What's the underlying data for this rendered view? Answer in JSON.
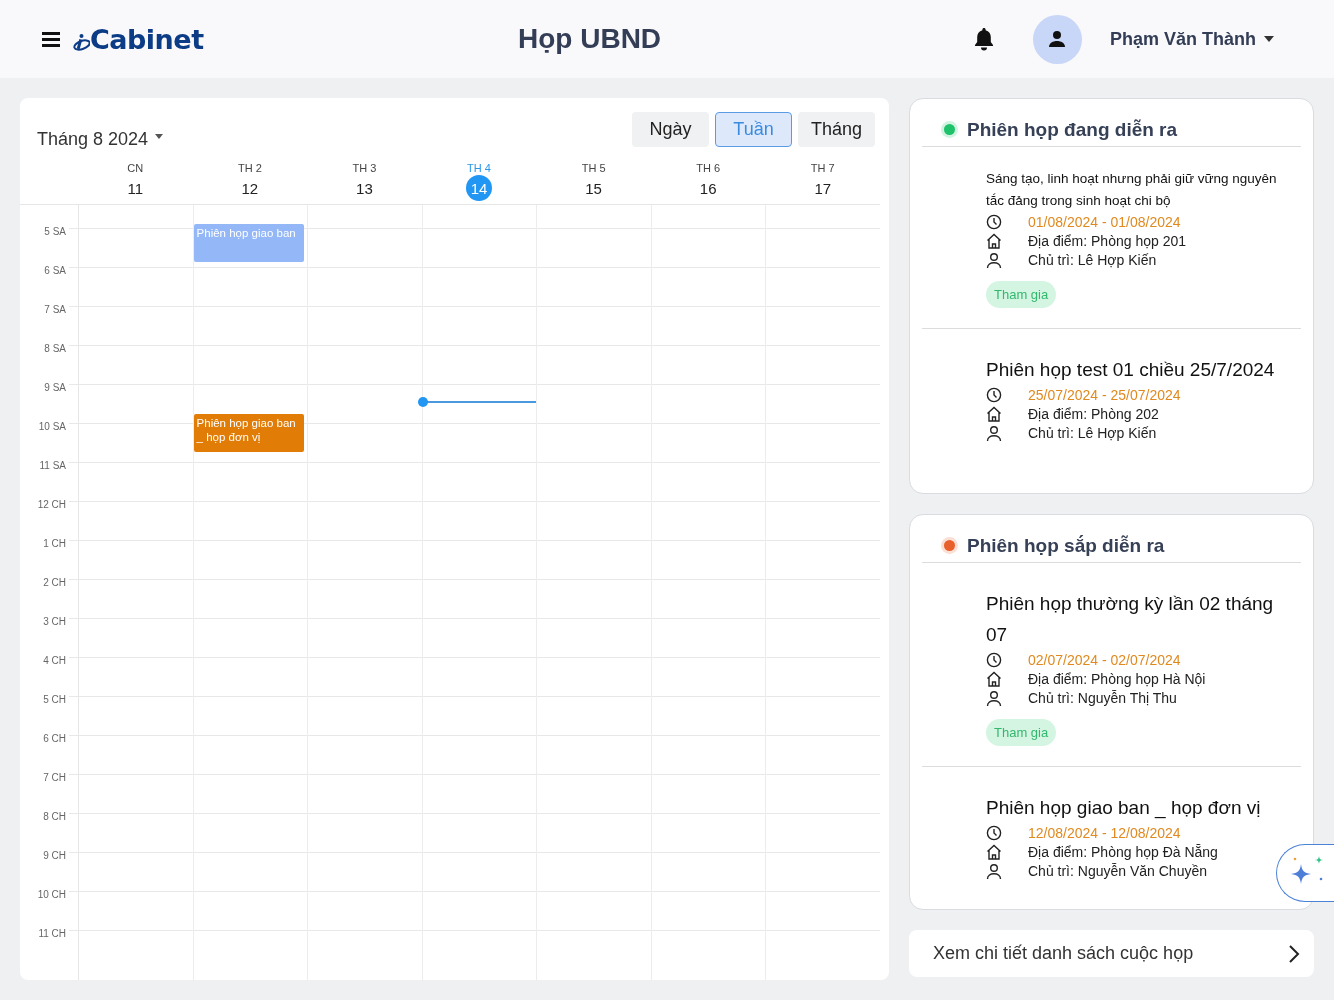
{
  "header": {
    "logo": "Cabinet",
    "title": "Họp UBND",
    "user_name": "Phạm Văn Thành"
  },
  "calendar": {
    "month_label": "Tháng 8 2024",
    "views": [
      {
        "label": "Ngày",
        "selected": false
      },
      {
        "label": "Tuần",
        "selected": true
      },
      {
        "label": "Tháng",
        "selected": false
      }
    ],
    "days": [
      {
        "name": "CN",
        "date": "11",
        "selected": false
      },
      {
        "name": "TH 2",
        "date": "12",
        "selected": false
      },
      {
        "name": "TH 3",
        "date": "13",
        "selected": false
      },
      {
        "name": "TH 4",
        "date": "14",
        "selected": true
      },
      {
        "name": "TH 5",
        "date": "15",
        "selected": false
      },
      {
        "name": "TH 6",
        "date": "16",
        "selected": false
      },
      {
        "name": "TH 7",
        "date": "17",
        "selected": false
      }
    ],
    "hours": [
      {
        "label": "5 SA",
        "events": [
          {
            "title": "Phiên họp giao ban",
            "color": "#93b7f7"
          }
        ]
      },
      {
        "label": "6 SA"
      },
      {
        "label": "7 SA"
      },
      {
        "label": "8 SA"
      },
      {
        "label": "9 SA",
        "now": true
      },
      {
        "label": "10 SA",
        "events": [
          {
            "title": "Phiên họp giao ban _ họp đơn vị",
            "color": "#e17c06"
          }
        ]
      },
      {
        "label": "11 SA"
      },
      {
        "label": "12 CH"
      },
      {
        "label": "1 CH"
      },
      {
        "label": "2 CH"
      },
      {
        "label": "3 CH"
      },
      {
        "label": "4 CH"
      },
      {
        "label": "5 CH"
      },
      {
        "label": "6 CH"
      },
      {
        "label": "7 CH"
      },
      {
        "label": "8 CH"
      },
      {
        "label": "9 CH"
      },
      {
        "label": "10 CH"
      },
      {
        "label": "11 CH"
      }
    ]
  },
  "panels": [
    {
      "title": "Phiên họp đang diễn ra",
      "color": "#1fc16b",
      "meetings": [
        {
          "kind": "small-title",
          "title": "Sáng tạo, linh hoạt nhưng phải giữ vững nguyên tắc đảng trong sinh hoạt chi bộ",
          "dates": "01/08/2024 - 01/08/2024",
          "location": "Địa điểm: Phòng họp 201",
          "chair": "Chủ trì: Lê Hợp Kiến",
          "action": "Tham gia"
        },
        {
          "kind": "large-title",
          "title": "Phiên họp test 01 chiều 25/7/2024",
          "dates": "25/07/2024 - 25/07/2024",
          "location": "Địa điểm: Phòng 202",
          "chair": "Chủ trì: Lê Hợp Kiến"
        }
      ]
    },
    {
      "title": "Phiên họp sắp diễn ra",
      "color": "#e8602c",
      "meetings": [
        {
          "kind": "large-title",
          "title": "Phiên họp thường kỳ lần 02 tháng 07",
          "dates": "02/07/2024 - 02/07/2024",
          "location": "Địa điểm: Phòng họp Hà Nội",
          "chair": "Chủ trì: Nguyễn Thị Thu",
          "action": "Tham gia"
        },
        {
          "kind": "large-title",
          "title": "Phiên họp giao ban _ họp đơn vị",
          "dates": "12/08/2024 - 12/08/2024",
          "location": "Địa điểm: Phòng họp Đà Nẵng",
          "chair": "Chủ trì: Nguyễn Văn Chuyền"
        }
      ]
    }
  ],
  "details_link": "Xem chi tiết danh sách cuộc họp"
}
